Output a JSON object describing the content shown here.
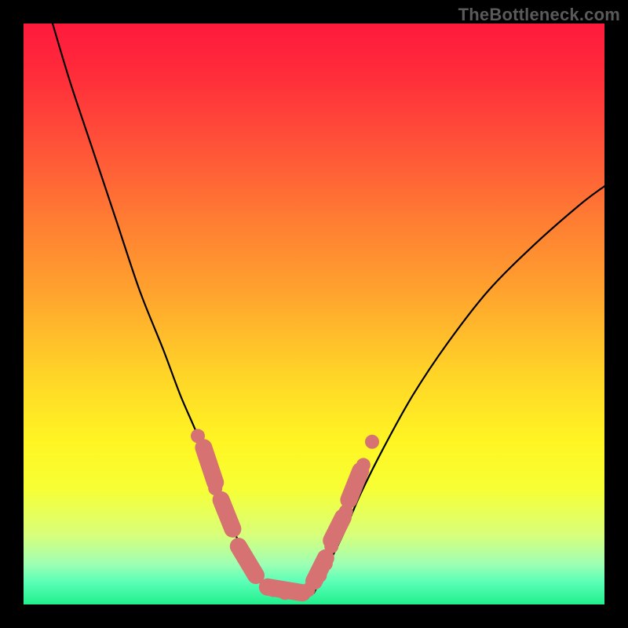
{
  "watermark": "TheBottleneck.com",
  "chart_data": {
    "type": "line",
    "title": "",
    "xlabel": "",
    "ylabel": "",
    "ylim": [
      0,
      100
    ],
    "xlim": [
      0,
      100
    ],
    "series": [
      {
        "name": "left-curve",
        "x": [
          5,
          8,
          12,
          16,
          20,
          24,
          27,
          30,
          32,
          34,
          36,
          38,
          40,
          42
        ],
        "y": [
          100,
          90,
          78,
          66,
          54,
          44,
          36,
          29,
          23,
          18,
          13,
          9,
          5,
          2
        ]
      },
      {
        "name": "right-curve",
        "x": [
          50,
          52,
          55,
          58,
          62,
          67,
          73,
          80,
          88,
          96,
          100
        ],
        "y": [
          2,
          6,
          12,
          19,
          27,
          36,
          45,
          54,
          62,
          69,
          72
        ]
      }
    ],
    "markers": {
      "name": "highlight-markers",
      "points": [
        {
          "x": 30,
          "y": 29
        },
        {
          "x": 31.5,
          "y": 26
        },
        {
          "x": 33,
          "y": 20
        },
        {
          "x": 34.5,
          "y": 16
        },
        {
          "x": 36,
          "y": 13
        },
        {
          "x": 37,
          "y": 10
        },
        {
          "x": 38,
          "y": 8
        },
        {
          "x": 40,
          "y": 5
        },
        {
          "x": 43,
          "y": 2.5
        },
        {
          "x": 45,
          "y": 2
        },
        {
          "x": 47,
          "y": 2
        },
        {
          "x": 49,
          "y": 2.5
        },
        {
          "x": 51,
          "y": 5
        },
        {
          "x": 52,
          "y": 7
        },
        {
          "x": 53,
          "y": 10
        },
        {
          "x": 54,
          "y": 13
        },
        {
          "x": 55.5,
          "y": 16
        },
        {
          "x": 57,
          "y": 20
        },
        {
          "x": 58.5,
          "y": 24
        },
        {
          "x": 60,
          "y": 28
        }
      ],
      "capsules": [
        {
          "x1": 31,
          "y1": 27,
          "x2": 33,
          "y2": 21
        },
        {
          "x1": 34,
          "y1": 18,
          "x2": 36,
          "y2": 13
        },
        {
          "x1": 37,
          "y1": 10,
          "x2": 40,
          "y2": 5
        },
        {
          "x1": 42,
          "y1": 3,
          "x2": 48,
          "y2": 2
        },
        {
          "x1": 50,
          "y1": 4,
          "x2": 52,
          "y2": 8
        },
        {
          "x1": 53,
          "y1": 11,
          "x2": 55,
          "y2": 15
        },
        {
          "x1": 56,
          "y1": 18,
          "x2": 58,
          "y2": 23
        }
      ]
    }
  }
}
